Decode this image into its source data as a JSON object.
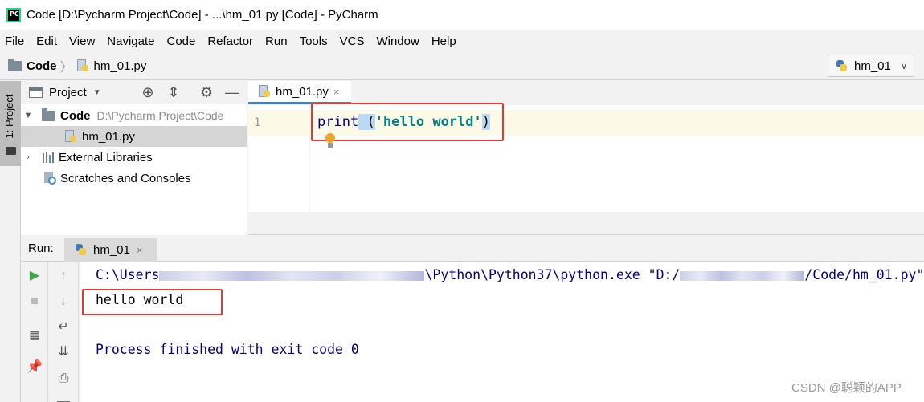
{
  "window": {
    "app_icon_text": "PC",
    "title": "Code [D:\\Pycharm Project\\Code] - ...\\hm_01.py [Code] - PyCharm"
  },
  "menu": [
    {
      "label": "File"
    },
    {
      "label": "Edit"
    },
    {
      "label": "View"
    },
    {
      "label": "Navigate"
    },
    {
      "label": "Code"
    },
    {
      "label": "Refactor"
    },
    {
      "label": "Run"
    },
    {
      "label": "Tools"
    },
    {
      "label": "VCS"
    },
    {
      "label": "Window"
    },
    {
      "label": "Help"
    }
  ],
  "breadcrumb": {
    "root": "Code",
    "separator": "〉",
    "file": "hm_01.py"
  },
  "run_config": {
    "label": "hm_01",
    "arrow": "∨"
  },
  "tool_stripe": {
    "project_label": "1: Project"
  },
  "project_panel": {
    "title": "Project",
    "dropdown_arrow": "▼",
    "tree": {
      "root_name": "Code",
      "root_path": "D:\\Pycharm Project\\Code",
      "file": "hm_01.py",
      "external_libraries": "External Libraries",
      "scratches": "Scratches and Consoles"
    }
  },
  "editor": {
    "tab_label": "hm_01.py",
    "tab_close": "×",
    "line_number": "1",
    "code": {
      "func": "print",
      "space": " ",
      "open": "(",
      "string": "'hello world'",
      "close": ")"
    }
  },
  "run_panel": {
    "label": "Run:",
    "tab_label": "hm_01",
    "tab_close": "×",
    "console": {
      "cmd_prefix": "C:\\Users",
      "cmd_mid": "\\Python\\Python37\\python.exe \"D:/",
      "cmd_suffix": "/Code/hm_01.py\"",
      "output": "hello world",
      "exit": "Process finished with exit code 0"
    }
  },
  "watermark": "CSDN @聪颖的APP",
  "colors": {
    "accent": "#4083c9",
    "annotation_box": "#e53935",
    "string": "#008080",
    "keyword": "#000080"
  }
}
